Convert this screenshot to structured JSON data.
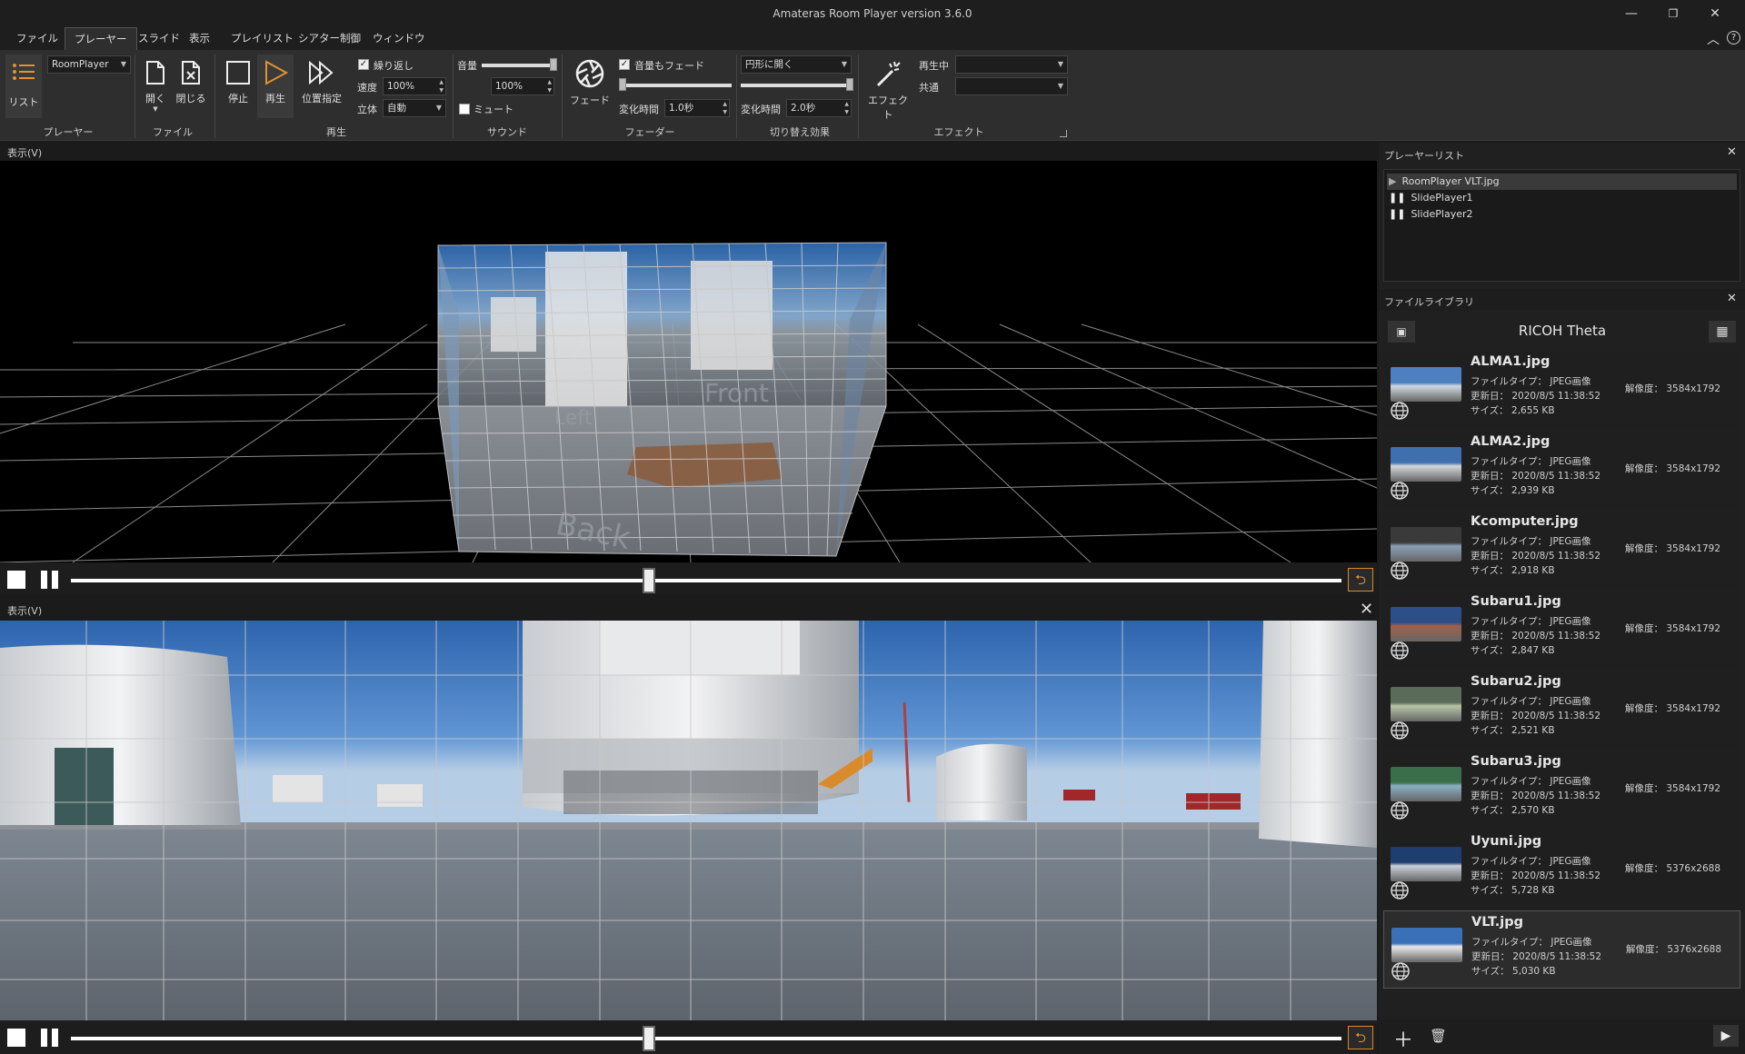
{
  "window": {
    "title": "Amateras Room Player version 3.6.0",
    "minimize": "—",
    "maximize": "❐",
    "close": "✕"
  },
  "menu": [
    "ファイル",
    "プレーヤー",
    "スライド",
    "表示",
    "プレイリスト",
    "シアター制御",
    "ウィンドウ"
  ],
  "ribbon": {
    "list_label": "リスト",
    "player_combo": "RoomPlayer",
    "open_label": "開く",
    "close_label": "閉じる",
    "stop_label": "停止",
    "play_label": "再生",
    "seek_label": "位置指定",
    "repeat_label": "繰り返し",
    "speed_label": "速度",
    "speed_value": "100%",
    "stereo_label": "立体",
    "stereo_value": "自動",
    "volume_label": "音量",
    "volume_value": "100%",
    "volume_level": 1.0,
    "mute_label": "ミュート",
    "fade_label": "フェード",
    "fade_volume_label": "音量もフェード",
    "fade_time_label": "変化時間",
    "fade_time_value": "1.0秒",
    "transition_combo": "円形に開く",
    "transition_time_label": "変化時間",
    "transition_time_value": "2.0秒",
    "effect_label": "エフェクト",
    "playing_label": "再生中",
    "common_label": "共通",
    "groups": {
      "player": "プレーヤー",
      "file": "ファイル",
      "play": "再生",
      "sound": "サウンド",
      "fader": "フェーダー",
      "transition": "切り替え効果",
      "effect": "エフェクト"
    }
  },
  "view_top": {
    "header": "表示(V)",
    "progress": 0.455
  },
  "view_bottom": {
    "header": "表示(V)",
    "progress": 0.455
  },
  "player_list": {
    "header": "プレーヤーリスト",
    "items": [
      {
        "label": "RoomPlayer VLT.jpg",
        "icon": "play-icon",
        "selected": true
      },
      {
        "label": "SlidePlayer1",
        "icon": "pause-icon",
        "selected": false
      },
      {
        "label": "SlidePlayer2",
        "icon": "pause-icon",
        "selected": false
      }
    ]
  },
  "library": {
    "header": "ファイルライブラリ",
    "title": "RICOH Theta",
    "type_label": "ファイルタイプ：",
    "date_label": "更新日：",
    "size_label": "サイズ：",
    "res_label": "解像度：",
    "items": [
      {
        "name": "ALMA1.jpg",
        "type": "JPEG画像",
        "date": "2020/8/5 11:38:52",
        "size": "2,655 KB",
        "res": "3584x1792"
      },
      {
        "name": "ALMA2.jpg",
        "type": "JPEG画像",
        "date": "2020/8/5 11:38:52",
        "size": "2,939 KB",
        "res": "3584x1792"
      },
      {
        "name": "Kcomputer.jpg",
        "type": "JPEG画像",
        "date": "2020/8/5 11:38:52",
        "size": "2,918 KB",
        "res": "3584x1792"
      },
      {
        "name": "Subaru1.jpg",
        "type": "JPEG画像",
        "date": "2020/8/5 11:38:52",
        "size": "2,847 KB",
        "res": "3584x1792"
      },
      {
        "name": "Subaru2.jpg",
        "type": "JPEG画像",
        "date": "2020/8/5 11:38:52",
        "size": "2,521 KB",
        "res": "3584x1792"
      },
      {
        "name": "Subaru3.jpg",
        "type": "JPEG画像",
        "date": "2020/8/5 11:38:52",
        "size": "2,570 KB",
        "res": "3584x1792"
      },
      {
        "name": "Uyuni.jpg",
        "type": "JPEG画像",
        "date": "2020/8/5 11:38:52",
        "size": "5,728 KB",
        "res": "5376x2688"
      },
      {
        "name": "VLT.jpg",
        "type": "JPEG画像",
        "date": "2020/8/5 11:38:52",
        "size": "5,030 KB",
        "res": "5376x2688",
        "selected": true
      }
    ]
  },
  "cube_text": {
    "front": "Front",
    "back": "Back",
    "left": "Left"
  },
  "colors": {
    "accent": "#e3922e",
    "sky": "#3f7fc9",
    "background": "#1b1b1b"
  }
}
